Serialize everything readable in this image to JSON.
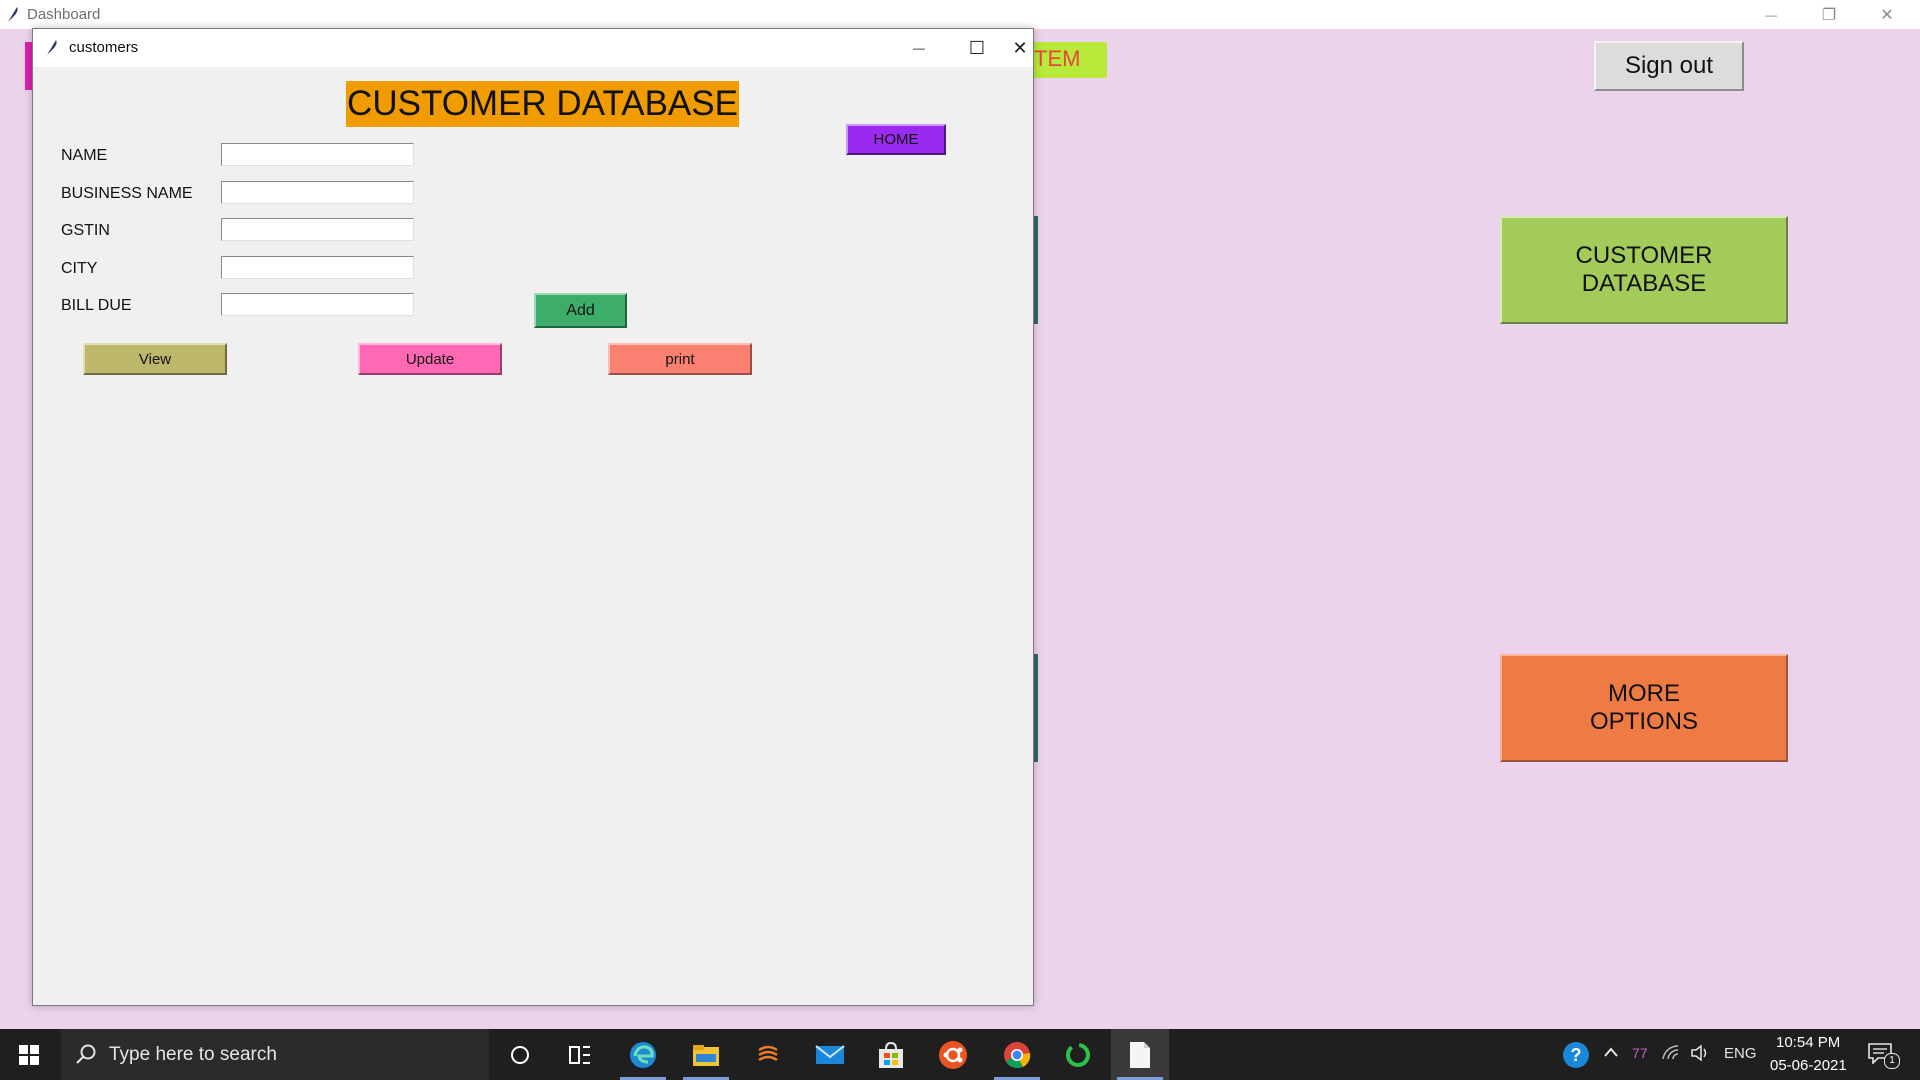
{
  "dashboard": {
    "title": "Dashboard",
    "system_label": "TEM",
    "signout_label": "Sign out",
    "customer_db_label": "CUSTOMER\nDATABASE",
    "more_options_label": "MORE\nOPTIONS",
    "minimize_glyph": "—",
    "restore_glyph": "❐",
    "close_glyph": "✕"
  },
  "customers_window": {
    "title": "customers",
    "heading": "CUSTOMER DATABASE",
    "home_label": "HOME",
    "minimize_glyph": "—",
    "maximize_glyph": "☐",
    "close_glyph": "✕",
    "fields": [
      {
        "label": "NAME",
        "value": ""
      },
      {
        "label": "BUSINESS NAME",
        "value": ""
      },
      {
        "label": "GSTIN",
        "value": ""
      },
      {
        "label": "CITY",
        "value": ""
      },
      {
        "label": "BILL DUE",
        "value": ""
      }
    ],
    "add_label": "Add",
    "view_label": "View",
    "update_label": "Update",
    "print_label": "print"
  },
  "taskbar": {
    "search_placeholder": "Type here to search",
    "tray_number": "77",
    "language": "ENG",
    "time": "10:54 PM",
    "date": "05-06-2021",
    "notification_count": "1",
    "apps": [
      "cortana-icon",
      "task-view-icon",
      "edge-icon",
      "file-explorer-icon",
      "sublime-icon",
      "mail-icon",
      "store-icon",
      "ubuntu-icon",
      "chrome-icon",
      "app-green-ring-icon",
      "notepad-icon"
    ]
  },
  "colors": {
    "dashboard_bg": "#ecd3ec",
    "heading_bg": "#f09c00",
    "home_bg": "#9a2af0",
    "add_bg": "#3dae6a",
    "view_bg": "#bdb76b",
    "update_bg": "#ff69b4",
    "print_bg": "#fa8072",
    "customer_db_bg": "#a3cb5a",
    "more_options_bg": "#ee7a44"
  }
}
